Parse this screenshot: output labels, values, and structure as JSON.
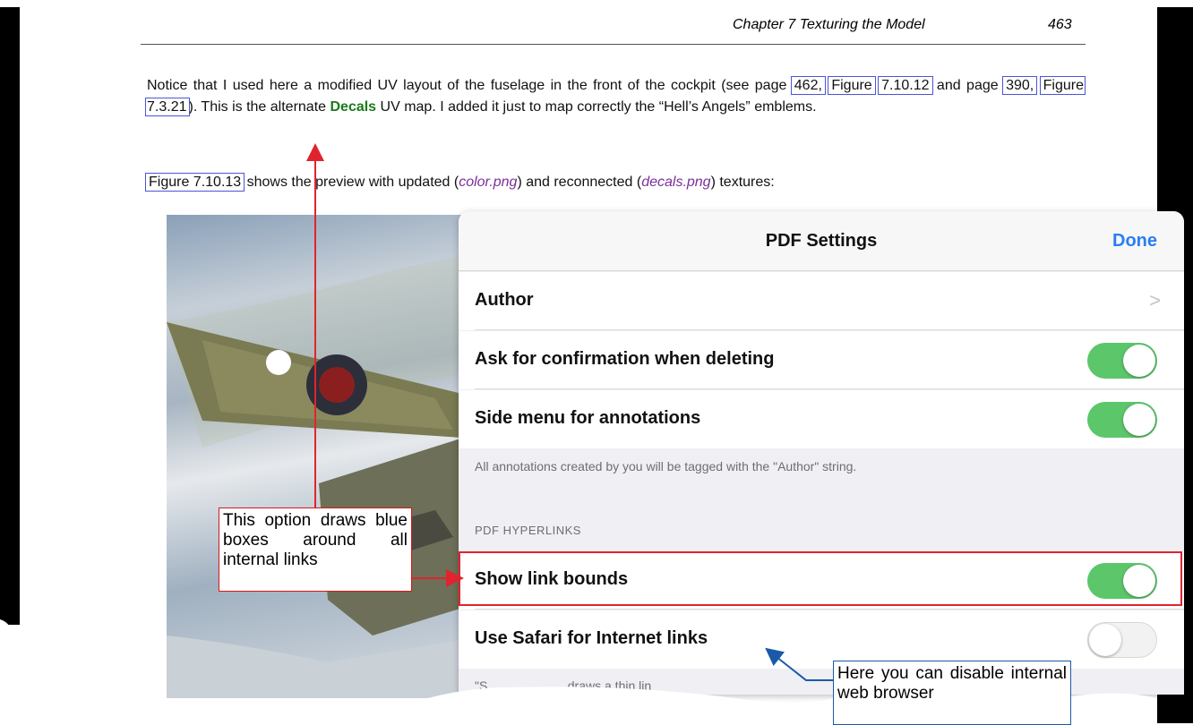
{
  "header": {
    "chapter_title": "Chapter 7 Texturing the Model",
    "page_number": "463"
  },
  "paragraph1": {
    "text_a": "Notice that I used here a modified UV layout of the fuselage in the front of the cockpit (see page ",
    "link_page_462": "462,",
    "link_fig_a": "Figure",
    "link_fig_b": "7.10.12",
    "text_b": " and page ",
    "link_page_390": "390,",
    "link_fig_7321": "Figure 7.3.21",
    "text_c": "). This is the alternate ",
    "decals_word": "Decals",
    "text_d": " UV map. I added it just to map correctly the “Hell’s Angels” emblems."
  },
  "paragraph2": {
    "link_fig_71013": "Figure 7.10.13",
    "text_a": " shows the preview with updated (",
    "file_color": "color.png",
    "text_b": ") and reconnected (",
    "file_decals": "decals.png",
    "text_c": ") textures:"
  },
  "settings_panel": {
    "title": "PDF Settings",
    "done_label": "Done",
    "rows": [
      {
        "label": "Author",
        "control": "chevron",
        "glyph": ">"
      },
      {
        "label": "Ask for confirmation when deleting",
        "control": "toggle",
        "on": true
      },
      {
        "label": "Side menu for annotations",
        "control": "toggle",
        "on": true
      }
    ],
    "footer_note": "All annotations created by you will be tagged with the \"Author\" string.",
    "section_header": "PDF HYPERLINKS",
    "link_rows": [
      {
        "label": "Show link bounds",
        "control": "toggle",
        "on": true
      },
      {
        "label": "Use Safari for Internet links",
        "control": "toggle",
        "on": false
      }
    ],
    "partial_footer_text": "\"S                       draws a thin lin"
  },
  "callouts": {
    "red": "This option draws blue boxes around all internal links",
    "blue": "Here you can disable internal web browser"
  },
  "colors": {
    "toggle_on": "#5cc66b",
    "done_blue": "#2a7ef3",
    "link_box": "#4b55d6",
    "callout_red": "#d11a1a",
    "callout_blue": "#1a5aa8"
  }
}
